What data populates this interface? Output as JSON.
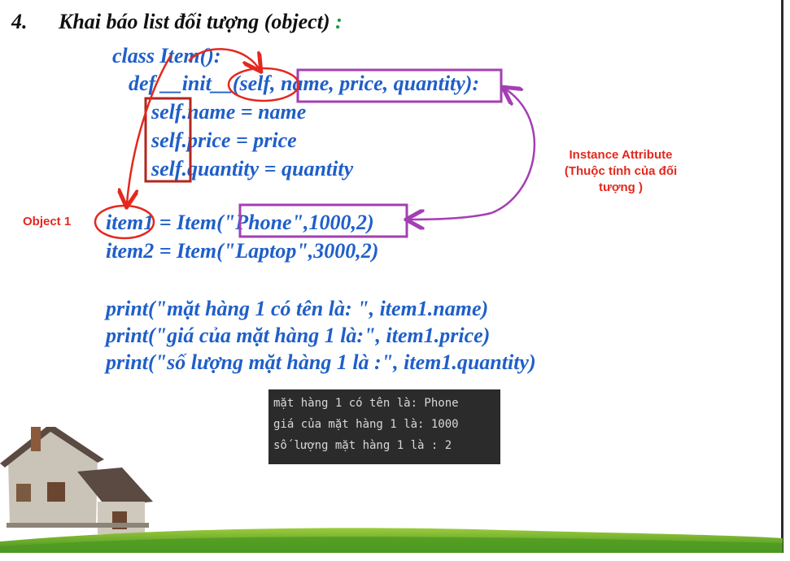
{
  "heading": {
    "number": "4.",
    "title": "Khai báo list đối tượng (object)",
    "colon": ":"
  },
  "code": {
    "class_line": "class Item():",
    "def_line": "def __init__(self, name, price, quantity):",
    "body": [
      "self.name = name",
      "self.price = price",
      "self.quantity = quantity"
    ],
    "item1": "item1 = Item(\"Phone\",1000,2)",
    "item2": "item2 = Item(\"Laptop\",3000,2)",
    "prints": [
      "print(\"mặt hàng 1 có tên là: \", item1.name)",
      "print(\"giá của mặt hàng 1 là:\", item1.price)",
      "print(\"số lượng mặt hàng 1 là :\", item1.quantity)"
    ]
  },
  "annotations": {
    "object_label": "Object 1",
    "instance_title": "Instance Attribute",
    "instance_sub1": "(Thuộc tính của đối",
    "instance_sub2": "tượng )"
  },
  "terminal": {
    "lines": [
      "mặt hàng 1 có tên là:  Phone",
      "giá của mặt hàng 1 là: 1000",
      "số lượng mặt hàng 1 là : 2"
    ]
  },
  "colors": {
    "code_blue": "#1f5fc8",
    "annotation_red": "#e4281e",
    "box_purple": "#a43fb3",
    "box_darkred": "#b3261e",
    "terminal_bg": "#2b2b2b",
    "colon_green": "#1e9a3c"
  }
}
